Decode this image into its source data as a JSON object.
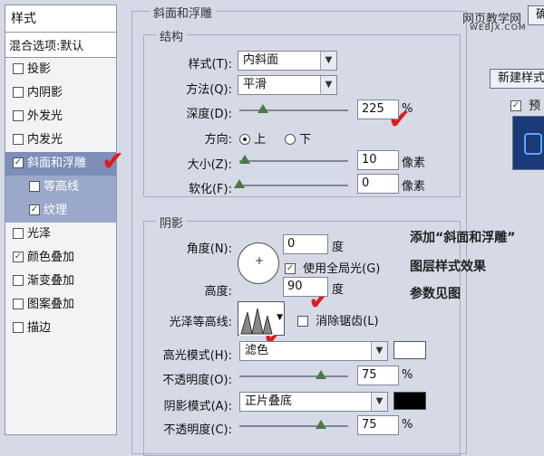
{
  "style_list": {
    "header": "样式",
    "blend_options": "混合选项:默认",
    "items": [
      {
        "label": "投影",
        "checked": false,
        "sub": false,
        "selected": false
      },
      {
        "label": "内阴影",
        "checked": false,
        "sub": false,
        "selected": false
      },
      {
        "label": "外发光",
        "checked": false,
        "sub": false,
        "selected": false
      },
      {
        "label": "内发光",
        "checked": false,
        "sub": false,
        "selected": false
      },
      {
        "label": "斜面和浮雕",
        "checked": true,
        "sub": false,
        "selected": true
      },
      {
        "label": "等高线",
        "checked": false,
        "sub": true,
        "selected": false
      },
      {
        "label": "纹理",
        "checked": true,
        "sub": true,
        "selected": false
      },
      {
        "label": "光泽",
        "checked": false,
        "sub": false,
        "selected": false
      },
      {
        "label": "颜色叠加",
        "checked": true,
        "sub": false,
        "selected": false
      },
      {
        "label": "渐变叠加",
        "checked": false,
        "sub": false,
        "selected": false
      },
      {
        "label": "图案叠加",
        "checked": false,
        "sub": false,
        "selected": false
      },
      {
        "label": "描边",
        "checked": false,
        "sub": false,
        "selected": false
      }
    ]
  },
  "bevel": {
    "title": "斜面和浮雕",
    "structure_title": "结构",
    "style_label": "样式(T):",
    "style_value": "内斜面",
    "technique_label": "方法(Q):",
    "technique_value": "平滑",
    "depth_label": "深度(D):",
    "depth_value": "225",
    "depth_unit": "%",
    "depth_level": 0.22,
    "direction_label": "方向:",
    "direction_up": "上",
    "direction_down": "下",
    "direction_selected": "up",
    "size_label": "大小(Z):",
    "size_value": "10",
    "size_unit": "像素",
    "size_level": 0.05,
    "soften_label": "软化(F):",
    "soften_value": "0",
    "soften_unit": "像素",
    "soften_level": 0.0
  },
  "shading": {
    "title": "阴影",
    "angle_label": "角度(N):",
    "angle_value": "0",
    "angle_unit": "度",
    "global_light_label": "使用全局光(G)",
    "global_light_checked": true,
    "altitude_label": "高度:",
    "altitude_value": "90",
    "altitude_unit": "度",
    "gloss_label": "光泽等高线:",
    "antialias_label": "消除锯齿(L)",
    "antialias_checked": false,
    "highlight_mode_label": "高光模式(H):",
    "highlight_mode_value": "滤色",
    "highlight_color": "#ffffff",
    "highlight_opacity_label": "不透明度(O):",
    "highlight_opacity_value": "75",
    "highlight_opacity_level": 0.75,
    "shadow_mode_label": "阴影模式(A):",
    "shadow_mode_value": "正片叠底",
    "shadow_color": "#000000",
    "shadow_opacity_label": "不透明度(C):",
    "shadow_opacity_value": "75",
    "shadow_opacity_level": 0.75,
    "percent": "%"
  },
  "right_panel": {
    "ok_button": "确",
    "new_style_button": "新建样式",
    "preview_label": "预",
    "preview_checked": true
  },
  "annotation": {
    "line1": "添加“斜面和浮雕”",
    "line2": "图层样式效果",
    "line3": "参数见图"
  },
  "watermark": {
    "text": "网页教学网",
    "url": "WEBJX.COM"
  },
  "colors": {
    "accent_check": "#e01b1b",
    "selected_item": "#7d8eb8"
  }
}
